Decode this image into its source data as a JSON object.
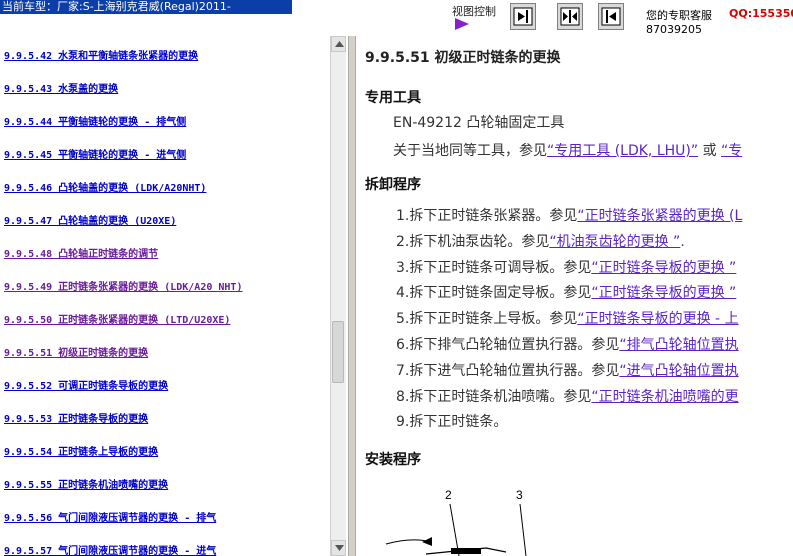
{
  "header": {
    "car_model": "当前车型：厂家:S-上海别克君威(Regal)2011-",
    "view_control": "视图控制",
    "service_label": "您的专职客服",
    "qq": "QQ:155350",
    "phone": "87039205"
  },
  "nav": {
    "items": [
      {
        "text": "9.9.5.42  水泵和平衡轴链条张紧器的更换",
        "visited": false
      },
      {
        "text": "9.9.5.43  水泵盖的更换",
        "visited": false
      },
      {
        "text": "9.9.5.44  平衡轴链轮的更换 - 排气侧",
        "visited": false
      },
      {
        "text": "9.9.5.45  平衡轴链轮的更换 - 进气侧",
        "visited": false
      },
      {
        "text": "9.9.5.46  凸轮轴盖的更换 (LDK/A20NHT)",
        "visited": false
      },
      {
        "text": "9.9.5.47  凸轮轴盖的更换 (U20XE)",
        "visited": false
      },
      {
        "text": "9.9.5.48  凸轮轴正时链条的调节",
        "visited": true
      },
      {
        "text": "9.9.5.49  正时链条张紧器的更换 (LDK/A20 NHT)",
        "visited": true
      },
      {
        "text": "9.9.5.50  正时链条张紧器的更换 (LTD/U20XE)",
        "visited": true
      },
      {
        "text": "9.9.5.51  初级正时链条的更换",
        "visited": true
      },
      {
        "text": "9.9.5.52  可调正时链条导板的更换",
        "visited": false
      },
      {
        "text": "9.9.5.53  正时链条导板的更换",
        "visited": false
      },
      {
        "text": "9.9.5.54  正时链条上导板的更换",
        "visited": false
      },
      {
        "text": "9.9.5.55  正时链条机油喷嘴的更换",
        "visited": false
      },
      {
        "text": "9.9.5.56  气门间隙液压调节器的更换 - 排气",
        "visited": false
      },
      {
        "text": "9.9.5.57  气门间隙液压调节器的更换 - 进气",
        "visited": false
      }
    ]
  },
  "doc": {
    "title": "9.9.5.51 初级正时链条的更换",
    "special_tools_heading": "专用工具",
    "tool_line": "EN-49212  凸轮轴固定工具",
    "equiv_text": "关于当地同等工具，参见",
    "equiv_link": "“专用工具 (LDK, LHU)”",
    "equiv_or": " 或 ",
    "equiv_link2": "“专",
    "removal_heading": "拆卸程序",
    "steps": [
      {
        "text": "1.拆下正时链条张紧器。参见",
        "link": "“正时链条张紧器的更换 (L"
      },
      {
        "text": "2.拆下机油泵齿轮。参见",
        "link": "“机油泵齿轮的更换 ”",
        "tail": "."
      },
      {
        "text": "3.拆下正时链条可调导板。参见",
        "link": "“正时链条导板的更换 ”"
      },
      {
        "text": "4.拆下正时链条固定导板。参见",
        "link": "“正时链条导板的更换 ”"
      },
      {
        "text": "5.拆下正时链条上导板。参见",
        "link": "“正时链条导板的更换 - 上"
      },
      {
        "text": "6.拆下排气凸轮轴位置执行器。参见",
        "link": "“排气凸轮轴位置执"
      },
      {
        "text": "7.拆下进气凸轮轴位置执行器。参见",
        "link": "“进气凸轮轴位置执"
      },
      {
        "text": "8.拆下正时链条机油喷嘴。参见",
        "link": "“正时链条机油喷嘴的更"
      },
      {
        "text": "9.拆下正时链条。",
        "link": ""
      }
    ],
    "install_heading": "安装程序",
    "callout_2": "2",
    "callout_3": "3"
  }
}
